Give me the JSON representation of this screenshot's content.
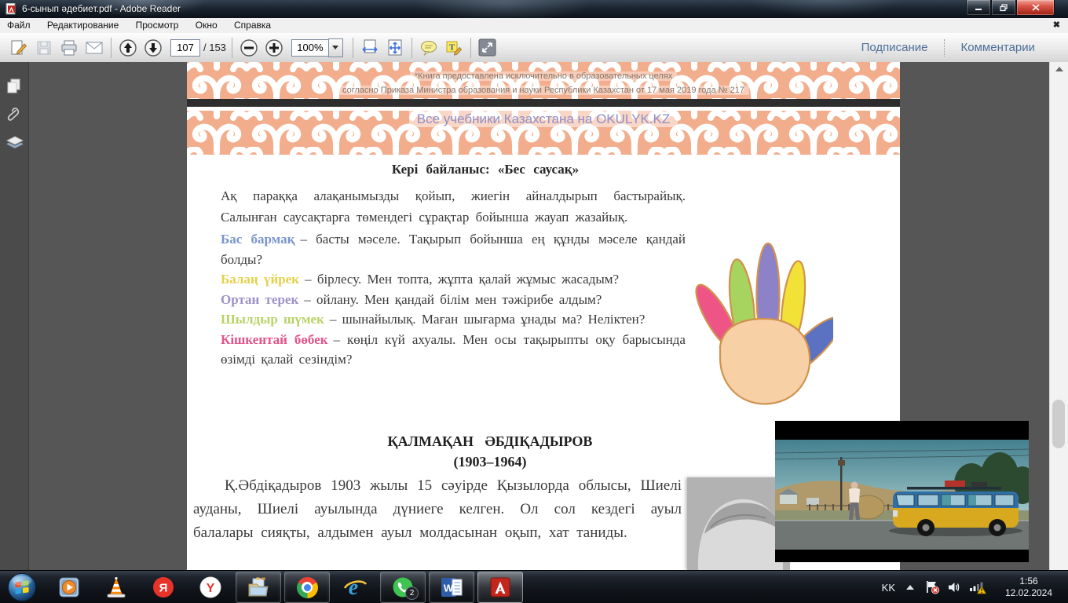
{
  "window": {
    "title": "6-сынып әдебиет.pdf - Adobe Reader"
  },
  "menubar": {
    "items": [
      "Файл",
      "Редактирование",
      "Просмотр",
      "Окно",
      "Справка"
    ],
    "close_glyph": "✖"
  },
  "toolbar": {
    "page_current": "107",
    "page_total": "/ 153",
    "zoom_level": "100%",
    "signing_label": "Подписание",
    "comments_label": "Комментарии"
  },
  "sidebar": {
    "icons": [
      "page-thumbnails",
      "attachments",
      "layers"
    ]
  },
  "document": {
    "watermark_line1": "*Книга предоставлена исключительно в образовательных целях",
    "watermark_line2": "согласно Приказа Министра образования и науки Республики Казахстан от 17 мая 2019 года № 217",
    "okulyk_banner": "Все учебники Казахстана на OKULYK.KZ",
    "section_heading": "Кері  байланыс:  «Бес  саусақ»",
    "intro_paragraph": "Ақ параққа алақанымызды қойып, жиегін айналдырып бастырайық. Салынған саусақтарға төмендегі сұрақтар бойынша жауап жазайық.",
    "fingers": [
      {
        "name": "Бас бармақ",
        "color": "#7b95ca",
        "text": "– басты мәселе. Тақырып бойынша ең құнды мәселе қандай болды?"
      },
      {
        "name": "Балаң үйрек",
        "color": "#e2d14c",
        "text": "– бірлесу. Мен топта, жұпта қалай жұмыс жасадым?"
      },
      {
        "name": "Ортан терек",
        "color": "#9d91c7",
        "text": "– ойлану. Мен қандай білім мен тәжірибе алдым?"
      },
      {
        "name": "Шылдыр шүмек",
        "color": "#b9d266",
        "text": "– шынайылық.  Маған шығарма ұнады ма?  Неліктен?"
      },
      {
        "name": "Кішкентай бөбек",
        "color": "#e4538a",
        "text": "– көңіл күй ахуалы.  Мен осы тақырыпты оқу барысында өзімді қалай сезіндім?"
      }
    ],
    "author_heading": "ҚАЛМАҚАН   ӘБДІҚАДЫРОВ",
    "author_years": "(1903–1964)",
    "bio_paragraph": "Қ.Әбдіқадыров 1903 жылы 15 сәуірде Қызылорда облысы, Шиелі ауданы, Шиелі ауылында дүниеге келген. Ол сол кездегі ауыл балалары сияқты, алдымен ауыл молдасынан оқып, хат",
    "bio_partial_line": "таниды."
  },
  "colors": {
    "ornament_salmon": "#f2ad8d",
    "okulyk_text": "#8f8fc6",
    "toolbar_link_blue": "#4f6f98",
    "hand_palm": "#f8d0a6",
    "hand_thumb_blue": "#5b72c2"
  },
  "taskbar": {
    "icons": [
      "start-orb",
      "windows-media-player",
      "vlc",
      "yandex-browser",
      "yandex-search",
      "file-explorer",
      "chrome",
      "internet-explorer",
      "whatsapp",
      "word",
      "adobe-reader"
    ],
    "whatsapp_badge": "2"
  },
  "tray": {
    "language": "KK",
    "time": "1:56",
    "date": "12.02.2024"
  }
}
